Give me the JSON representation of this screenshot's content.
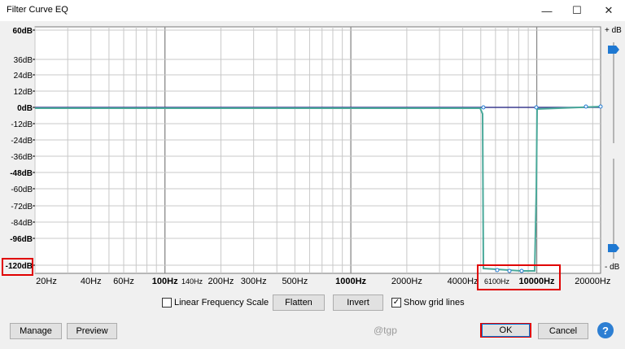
{
  "window": {
    "title": "Filter Curve EQ",
    "minimize_glyph": "—",
    "maximize_glyph": "☐",
    "close_glyph": "✕"
  },
  "graph": {
    "db_labels": [
      "60dB",
      "36dB",
      "24dB",
      "12dB",
      "0dB",
      "-12dB",
      "-24dB",
      "-36dB",
      "-48dB",
      "-60dB",
      "-72dB",
      "-84dB",
      "-96dB",
      "-120dB"
    ],
    "db_bold": [
      "60dB",
      "0dB",
      "-48dB",
      "-96dB",
      "-120dB"
    ],
    "freq_labels": [
      "20Hz",
      "40Hz",
      "60Hz",
      "100Hz",
      "140Hz",
      "200Hz",
      "300Hz",
      "500Hz",
      "1000Hz",
      "2000Hz",
      "4000Hz",
      "6100Hz",
      "10000Hz",
      "20000Hz"
    ],
    "freq_bold": [
      "100Hz",
      "1000Hz",
      "10000Hz"
    ],
    "right_top_label": "+ dB",
    "right_bottom_label": "- dB",
    "colors": {
      "curve": "#4aa99a",
      "flat_line": "#3b3b8f",
      "grid": "#c8c8c8",
      "slider": "#1e78d2"
    }
  },
  "controls": {
    "linear_scale_label": "Linear Frequency Scale",
    "linear_scale_checked": false,
    "flatten_label": "Flatten",
    "invert_label": "Invert",
    "grid_lines_label": "Show grid lines",
    "grid_lines_checked": true
  },
  "footer": {
    "manage_label": "Manage",
    "preview_label": "Preview",
    "watermark": "@tgp",
    "ok_label": "OK",
    "cancel_label": "Cancel",
    "help_glyph": "?"
  }
}
